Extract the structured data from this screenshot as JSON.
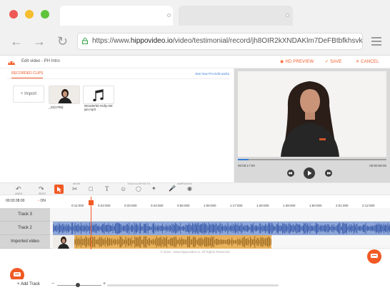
{
  "browser": {
    "url_prefix": "https://www.",
    "url_domain": "hippovideo.io",
    "url_path": "/video/testimonial/record/jh8OIR2kXNDAKlm7DeFBtbfkhsvkga..."
  },
  "header": {
    "title": "Edit video - PH Intro",
    "hd_preview": "HD PREVIEW",
    "save": "SAVE",
    "cancel": "CANCEL"
  },
  "clips_panel": {
    "tab_label": "RECORDED CLIPS",
    "show_link": "See how Pro Edit works",
    "import_label": "+ Import",
    "clips": [
      {
        "caption": "_23(1796)"
      },
      {
        "caption": "Wonderful-Holly-Intr gio.mp3"
      }
    ]
  },
  "player": {
    "current_time": "00:00:17:00",
    "total_time": "00:00:59:00",
    "progress": 0.07
  },
  "toolbar": {
    "undo": "UNDO",
    "redo": "REDO",
    "move": "MOVE",
    "tools_effects": "TOOLS & EFFECTS",
    "narration": "NARRATION"
  },
  "timeline": {
    "current_time": "00:03:38:00",
    "on_label": "ON",
    "ticks": [
      "0:11:000",
      "0:22:000",
      "0:33:000",
      "0:44:000",
      "0:55:000",
      "1:06:000",
      "1:17:000",
      "1:28:000",
      "1:39:000",
      "1:50:000",
      "2:01:000",
      "2:12:000"
    ],
    "tracks": [
      {
        "label": "Track 3"
      },
      {
        "label": "Track 2"
      },
      {
        "label": "Imported video"
      }
    ]
  },
  "footer": {
    "copyright": "© 2018 - www.hippovideo.io. All Rights Reserved",
    "add_track": "+ Add Track"
  },
  "colors": {
    "accent": "#f15a24",
    "audio_track": "#8ea7d8",
    "video_track": "#e8b15c"
  }
}
